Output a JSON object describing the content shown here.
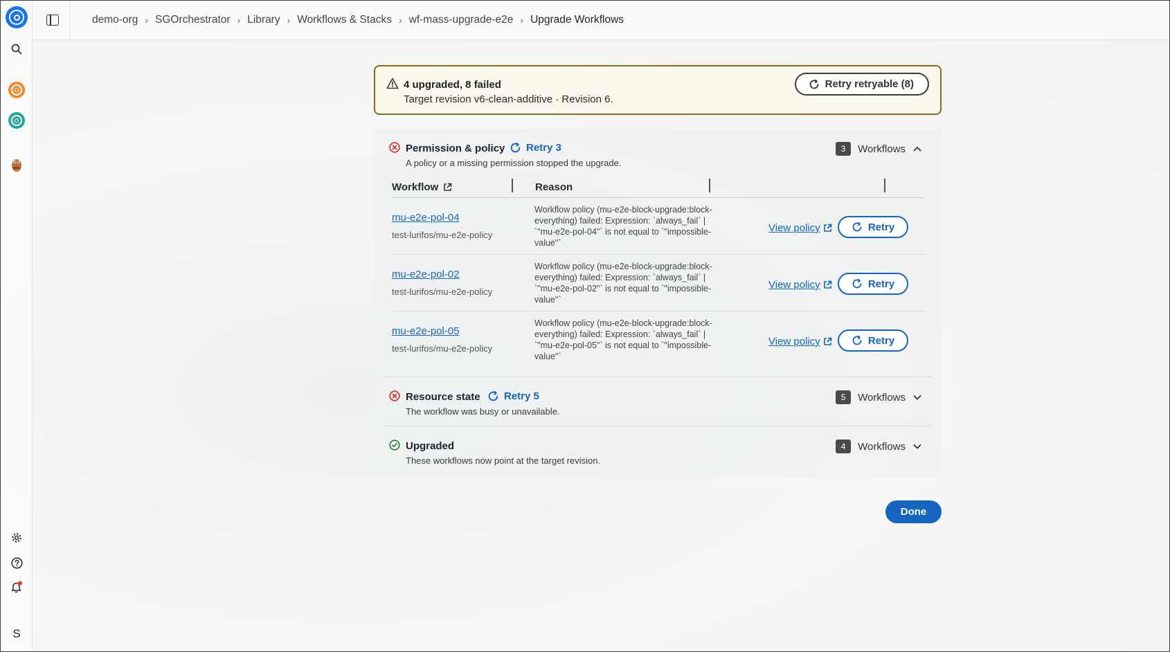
{
  "header": {
    "breadcrumb": [
      "demo-org",
      "SGOrchestrator",
      "Library",
      "Workflows & Stacks",
      "wf-mass-upgrade-e2e",
      "Upgrade Workflows"
    ]
  },
  "rail": {
    "avatar_letter": "S"
  },
  "banner": {
    "title": "4 upgraded, 8 failed",
    "subtitle": "Target revision v6-clean-additive · Revision 6.",
    "retry_label": "Retry retryable (8)"
  },
  "sections": {
    "policy": {
      "title": "Permission & policy",
      "retry_label": "Retry 3",
      "description": "A policy or a missing permission stopped the upgrade.",
      "count": "3",
      "count_label": "Workflows",
      "columns": {
        "workflow": "Workflow",
        "reason": "Reason"
      },
      "rows": [
        {
          "name": "mu-e2e-pol-04",
          "path": "test-lurifos/mu-e2e-policy",
          "reason": "Workflow policy (mu-e2e-block-upgrade:block-everything) failed: Expression: `always_fail` | `\"mu-e2e-pol-04\"` is not equal to `\"impossible-value\"`",
          "view_label": "View policy",
          "retry_label": "Retry"
        },
        {
          "name": "mu-e2e-pol-02",
          "path": "test-lurifos/mu-e2e-policy",
          "reason": "Workflow policy (mu-e2e-block-upgrade:block-everything) failed: Expression: `always_fail` | `\"mu-e2e-pol-02\"` is not equal to `\"impossible-value\"`",
          "view_label": "View policy",
          "retry_label": "Retry"
        },
        {
          "name": "mu-e2e-pol-05",
          "path": "test-lurifos/mu-e2e-policy",
          "reason": "Workflow policy (mu-e2e-block-upgrade:block-everything) failed: Expression: `always_fail` | `\"mu-e2e-pol-05\"` is not equal to `\"impossible-value\"`",
          "view_label": "View policy",
          "retry_label": "Retry"
        }
      ]
    },
    "resource": {
      "title": "Resource state",
      "retry_label": "Retry 5",
      "description": "The workflow was busy or unavailable.",
      "count": "5",
      "count_label": "Workflows"
    },
    "upgraded": {
      "title": "Upgraded",
      "description": "These workflows now point at the target revision.",
      "count": "4",
      "count_label": "Workflows"
    }
  },
  "footer": {
    "done_label": "Done"
  },
  "colors": {
    "accent": "#1565c0",
    "error": "#d32f2f",
    "success": "#2e7d32",
    "warning_border": "#8a6a1f",
    "rail_orange": "#f08a2c",
    "rail_teal": "#26a69a"
  }
}
